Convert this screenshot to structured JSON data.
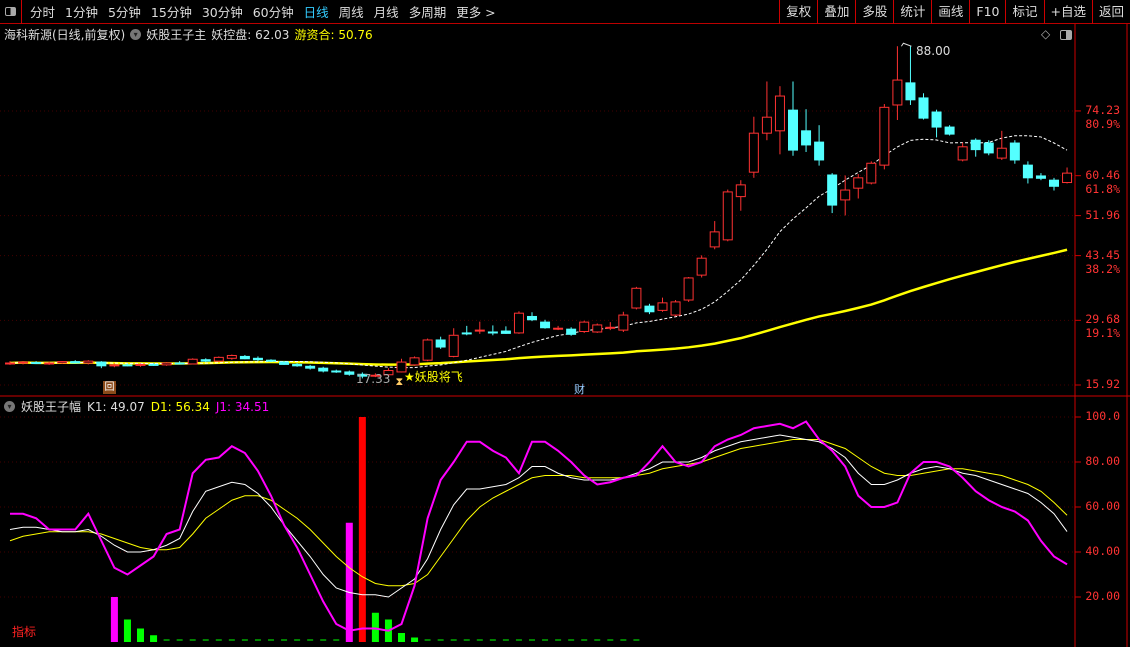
{
  "toolbar": {
    "periods": [
      "分时",
      "1分钟",
      "5分钟",
      "15分钟",
      "30分钟",
      "60分钟",
      "日线",
      "周线",
      "月线",
      "多周期",
      "更多 >"
    ],
    "active": "日线",
    "buttons": [
      "复权",
      "叠加",
      "多股",
      "统计",
      "画线",
      "F10",
      "标记",
      "+自选",
      "返回"
    ]
  },
  "main": {
    "stock": "海科新源(日线,前复权)",
    "indicator": "妖股王子主",
    "ind1_label": "妖控盘:",
    "ind1_value": "62.03",
    "ind2_label": "游资合:",
    "ind2_value": "50.76",
    "axis_labels": [
      {
        "v": 74.23,
        "t": "74.23",
        "p": "80.9%"
      },
      {
        "v": 60.46,
        "t": "60.46",
        "p": "61.8%"
      },
      {
        "v": 51.96,
        "t": "51.96",
        "p": ""
      },
      {
        "v": 43.45,
        "t": "43.45",
        "p": "38.2%"
      },
      {
        "v": 29.68,
        "t": "29.68",
        "p": "19.1%"
      },
      {
        "v": 15.92,
        "t": "15.92",
        "p": ""
      }
    ],
    "high_label": "88.00",
    "low_label": "17.33",
    "signal_label": "★妖股将飞",
    "marker_hui": "回",
    "marker_cai": "财",
    "colors": {
      "up": "#ff3232",
      "down": "#54ffff",
      "ma_fast": "#ffffff",
      "ma_slow": "#ffff00"
    }
  },
  "chart_data": {
    "type": "candlestick",
    "price_range": [
      15.92,
      88.0
    ],
    "ohlc": [
      [
        20.5,
        21,
        20.2,
        20.6
      ],
      [
        20.6,
        21,
        20.3,
        20.8
      ],
      [
        20.7,
        21,
        20.4,
        20.5
      ],
      [
        20.5,
        20.9,
        20.2,
        20.6
      ],
      [
        20.6,
        21,
        20.4,
        20.9
      ],
      [
        20.9,
        21.2,
        20.5,
        20.6
      ],
      [
        20.6,
        21.2,
        20.3,
        21
      ],
      [
        20.8,
        21,
        19.5,
        20
      ],
      [
        20,
        20.5,
        19.7,
        20.2
      ],
      [
        20.2,
        20.5,
        19.9,
        20.1
      ],
      [
        20.1,
        20.5,
        19.8,
        20.3
      ],
      [
        20.3,
        20.6,
        20,
        20.2
      ],
      [
        20.2,
        20.8,
        20,
        20.6
      ],
      [
        20.6,
        21,
        20.3,
        20.4
      ],
      [
        20.4,
        21.6,
        20.3,
        21.4
      ],
      [
        21.3,
        21.6,
        20.8,
        21
      ],
      [
        21,
        22,
        20.8,
        21.8
      ],
      [
        21.6,
        22.4,
        21.3,
        22.2
      ],
      [
        22,
        22.3,
        21.4,
        21.5
      ],
      [
        21.6,
        22,
        21,
        21.3
      ],
      [
        21.2,
        21.4,
        20.8,
        21
      ],
      [
        20.8,
        21,
        20.2,
        20.3
      ],
      [
        20.3,
        20.6,
        19.8,
        20
      ],
      [
        19.9,
        20.2,
        19.2,
        19.5
      ],
      [
        19.5,
        19.8,
        18.6,
        18.9
      ],
      [
        18.9,
        19.2,
        18.5,
        18.7
      ],
      [
        18.7,
        19,
        17.9,
        18.2
      ],
      [
        18.2,
        18.6,
        17.33,
        17.8
      ],
      [
        17.9,
        18.4,
        17.6,
        18
      ],
      [
        18.1,
        19.5,
        18,
        19
      ],
      [
        18.7,
        21.5,
        18.6,
        20.8
      ],
      [
        20.2,
        22,
        20,
        21.7
      ],
      [
        21.2,
        25.8,
        21,
        25.5
      ],
      [
        25.5,
        26.2,
        23.6,
        24
      ],
      [
        22,
        28,
        21.8,
        26.5
      ],
      [
        27,
        28.5,
        26.5,
        26.8
      ],
      [
        27.4,
        29.4,
        26.8,
        27.6
      ],
      [
        27.2,
        28.6,
        26.5,
        27
      ],
      [
        27.4,
        28.4,
        26.8,
        26.9
      ],
      [
        27,
        31.6,
        26.8,
        31.2
      ],
      [
        30.5,
        31.4,
        29.5,
        29.8
      ],
      [
        29.3,
        29.8,
        27.9,
        28.1
      ],
      [
        27.8,
        28.5,
        27.6,
        28
      ],
      [
        27.8,
        28.2,
        26.4,
        26.7
      ],
      [
        27.3,
        29.6,
        27,
        29.3
      ],
      [
        27.2,
        29,
        27,
        28.7
      ],
      [
        28,
        29.3,
        27.6,
        28.2
      ],
      [
        27.6,
        31.5,
        27.2,
        30.8
      ],
      [
        32.3,
        36.8,
        32,
        36.5
      ],
      [
        32.7,
        33.2,
        31,
        31.5
      ],
      [
        31.8,
        34.5,
        31.5,
        33.4
      ],
      [
        30.8,
        34,
        30.5,
        33.6
      ],
      [
        34,
        38.9,
        33.6,
        38.7
      ],
      [
        39.3,
        43.5,
        38.8,
        42.9
      ],
      [
        45.3,
        50.8,
        44.8,
        48.5
      ],
      [
        46.8,
        57.5,
        46.5,
        57
      ],
      [
        56,
        59.5,
        53,
        58.5
      ],
      [
        61.2,
        73,
        60,
        69.5
      ],
      [
        69.5,
        80.5,
        68,
        72.9
      ],
      [
        70,
        79.5,
        65,
        77.4
      ],
      [
        74.4,
        80.5,
        64.7,
        65.9
      ],
      [
        70,
        74.6,
        65.5,
        67
      ],
      [
        67.6,
        71.2,
        62.6,
        63.8
      ],
      [
        60.6,
        61,
        52.5,
        54.2
      ],
      [
        55.3,
        60.5,
        52,
        57.4
      ],
      [
        57.8,
        60.8,
        55.6,
        60
      ],
      [
        58.9,
        63.5,
        58.6,
        63.1
      ],
      [
        62.7,
        75.7,
        61.8,
        75
      ],
      [
        75.5,
        88,
        72.3,
        80.8
      ],
      [
        80.2,
        88,
        75.5,
        76.6
      ],
      [
        77,
        78,
        72.4,
        72.7
      ],
      [
        74,
        74.5,
        68.6,
        70.8
      ],
      [
        70.8,
        71.2,
        69,
        69.3
      ],
      [
        63.8,
        67.5,
        63.5,
        66.6
      ],
      [
        68,
        68.4,
        64.5,
        66
      ],
      [
        67.4,
        68,
        64.8,
        65.3
      ],
      [
        64.2,
        70,
        63.8,
        66.3
      ],
      [
        67.4,
        68,
        63,
        63.8
      ],
      [
        62.7,
        63.5,
        58.8,
        60
      ],
      [
        60.4,
        61,
        59.5,
        59.9
      ],
      [
        59.5,
        60,
        57.3,
        58.2
      ],
      [
        59,
        62.2,
        58.8,
        61
      ]
    ]
  },
  "sub": {
    "title": "妖股王子幅",
    "k_label": "K1:",
    "k_value": "49.07",
    "d_label": "D1:",
    "d_value": "56.34",
    "j_label": "J1:",
    "j_value": "34.51",
    "corner_label": "指标",
    "axis_labels": [
      {
        "v": 100,
        "t": "100.0"
      },
      {
        "v": 80,
        "t": "80.00"
      },
      {
        "v": 60,
        "t": "60.00"
      },
      {
        "v": 40,
        "t": "40.00"
      },
      {
        "v": 20,
        "t": "20.00"
      }
    ],
    "J": [
      57,
      57,
      55,
      50,
      50,
      50,
      57,
      45,
      33,
      30,
      34,
      38,
      48,
      50,
      75,
      81,
      82,
      87,
      84,
      76,
      65,
      52,
      42,
      30,
      18,
      8,
      5,
      6,
      6,
      5,
      8,
      25,
      55,
      72,
      80,
      89,
      89,
      85,
      82,
      75,
      89,
      89,
      85,
      80,
      74,
      70,
      71,
      73,
      74,
      80,
      87,
      80,
      78,
      80,
      87,
      90,
      92,
      95,
      96,
      97,
      95,
      98,
      90,
      85,
      78,
      65,
      60,
      60,
      62,
      75,
      80,
      80,
      78,
      73,
      67,
      63,
      60,
      58,
      54,
      45,
      38,
      34.51
    ],
    "K": [
      50,
      51,
      51,
      50,
      49,
      49,
      50,
      47,
      43,
      40,
      40,
      41,
      43,
      46,
      58,
      67,
      69,
      71,
      70,
      66,
      60,
      52,
      45,
      38,
      30,
      24,
      22,
      21,
      21,
      20,
      24,
      28,
      37,
      50,
      61,
      68,
      68,
      69,
      70,
      73,
      78,
      78,
      75,
      73,
      72,
      72,
      72,
      73,
      75,
      77,
      80,
      80,
      80,
      82,
      85,
      87,
      89,
      90,
      91,
      92,
      91,
      90,
      89,
      86,
      82,
      75,
      70,
      70,
      72,
      75,
      77,
      78,
      77,
      75,
      74,
      72,
      70,
      68,
      66,
      62,
      57,
      49.07
    ],
    "D": [
      45,
      47,
      48,
      49,
      49,
      49,
      49,
      48,
      46,
      44,
      42,
      41,
      41,
      42,
      48,
      55,
      59,
      63,
      65,
      65,
      63,
      59,
      55,
      50,
      44,
      38,
      33,
      29,
      26,
      25,
      25,
      26,
      30,
      38,
      46,
      54,
      60,
      64,
      67,
      70,
      73,
      74,
      74,
      74,
      73,
      73,
      73,
      73,
      74,
      75,
      77,
      78,
      79,
      80,
      82,
      84,
      86,
      87,
      88,
      89,
      90,
      90,
      90,
      88,
      86,
      82,
      78,
      75,
      74,
      74,
      75,
      76,
      77,
      77,
      76,
      75,
      74,
      72,
      70,
      67,
      62,
      56.34
    ],
    "bars": [
      {
        "i": 8,
        "v": 20,
        "c": "#ff00ff"
      },
      {
        "i": 9,
        "v": 10,
        "c": "#00ff00"
      },
      {
        "i": 10,
        "v": 6,
        "c": "#00ff00"
      },
      {
        "i": 11,
        "v": 3,
        "c": "#00ff00"
      },
      {
        "i": 26,
        "v": 53,
        "c": "#ff00ff"
      },
      {
        "i": 27,
        "v": 100,
        "c": "#ff0000"
      },
      {
        "i": 28,
        "v": 13,
        "c": "#00ff00"
      },
      {
        "i": 29,
        "v": 10,
        "c": "#00ff00"
      },
      {
        "i": 30,
        "v": 4,
        "c": "#00ff00"
      },
      {
        "i": 31,
        "v": 2,
        "c": "#00ff00"
      }
    ]
  }
}
